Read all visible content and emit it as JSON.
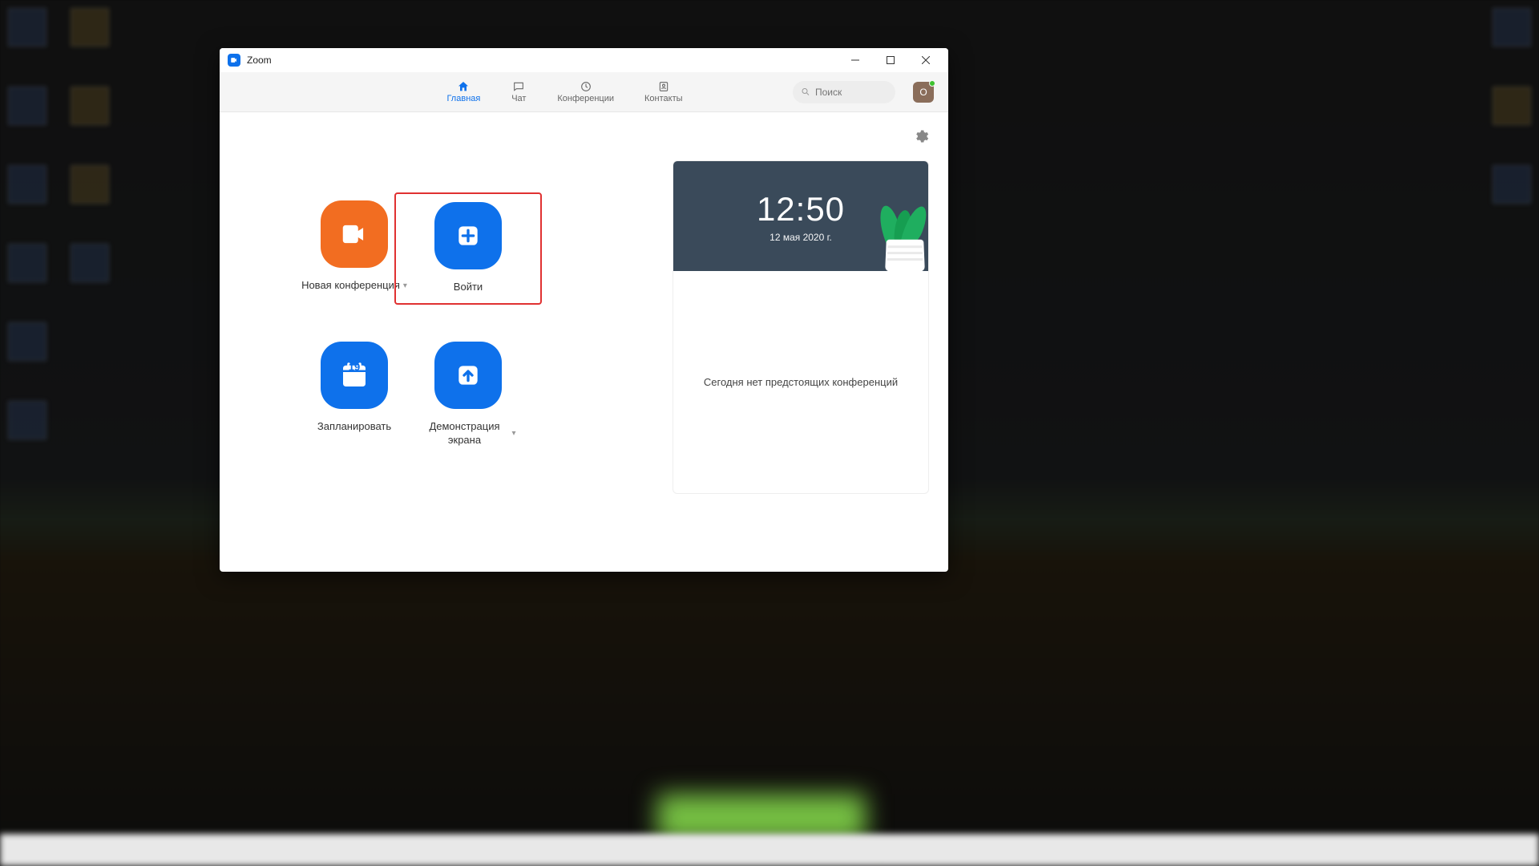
{
  "window": {
    "title": "Zoom"
  },
  "nav": {
    "items": [
      {
        "label": "Главная"
      },
      {
        "label": "Чат"
      },
      {
        "label": "Конференции"
      },
      {
        "label": "Контакты"
      }
    ],
    "search_placeholder": "Поиск",
    "avatar_initial": "O"
  },
  "tiles": {
    "new_meeting": "Новая конференция",
    "join": "Войти",
    "schedule": "Запланировать",
    "share_screen": "Демонстрация экрана",
    "calendar_day": "19"
  },
  "side": {
    "time": "12:50",
    "date": "12 мая 2020 г.",
    "empty": "Сегодня нет предстоящих конференций"
  }
}
